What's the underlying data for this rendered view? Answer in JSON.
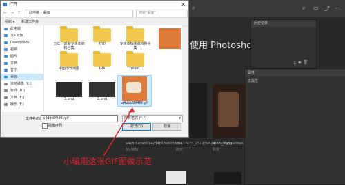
{
  "dialog": {
    "title": "打开",
    "breadcrumb": [
      "此电脑",
      "桌面"
    ],
    "search_placeholder": "搜索\"桌面\"",
    "toolbar": {
      "organize": "组织 ▾",
      "new_folder": "新建文件夹"
    },
    "sidebar": [
      {
        "label": "此电脑"
      },
      {
        "label": "3D 对象"
      },
      {
        "label": "Downloads"
      },
      {
        "label": "视频"
      },
      {
        "label": "图片"
      },
      {
        "label": "文档"
      },
      {
        "label": "音乐"
      },
      {
        "label": "桌面"
      },
      {
        "label": "本地磁盘 (C:)"
      },
      {
        "label": "软件 (D:)"
      },
      {
        "label": "文档 (E:)"
      },
      {
        "label": "娱乐 (F:)"
      }
    ],
    "files_row1": [
      {
        "label": "五年一贯制专转本资料合集"
      },
      {
        "label": "打印"
      },
      {
        "label": "专转本相关资料整合集"
      }
    ],
    "files_row2": [
      {
        "label": "中国历代地图"
      },
      {
        "label": "GM"
      },
      {
        "label": "main"
      }
    ],
    "files_row3": [
      {
        "label": "3.png"
      },
      {
        "label": "2.png"
      },
      {
        "label": "a4ddd9946f.gif"
      }
    ],
    "filename_label": "文件名(N):",
    "filename_value": "a4ddd9946f.gif",
    "checkbox_label": "图像序列",
    "filetype_value": "所有格式 (*.*)",
    "open_button": "打开(O)",
    "cancel_button": "取消"
  },
  "photoshop": {
    "welcome_text": "使用 Photoshop。",
    "history_panel": "历史记录",
    "properties_panel": "属性",
    "properties_sub": "无属性",
    "captions": [
      {
        "name": "a4e5f1acab014234b13a60385f...",
        "sub": "9分钟前"
      },
      {
        "name": "29417073_232239629000_2.jpg",
        "sub": "昨天"
      },
      {
        "name": "4f775f0a5aa0890d29",
        "sub": "昨天"
      }
    ]
  },
  "annotation": "小编用这张GIF图做示范",
  "colors": {
    "annotation": "#d9242a",
    "ps_bg": "#2b2b2b"
  }
}
